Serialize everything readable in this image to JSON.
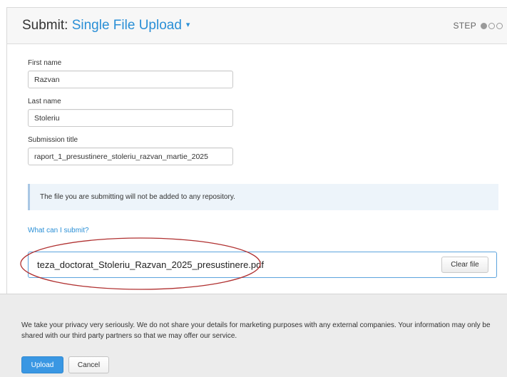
{
  "header": {
    "title_prefix": "Submit: ",
    "title_dropdown": "Single File Upload",
    "caret": "▾",
    "step_label": "STEP",
    "steps_total": 3,
    "current_step": 1
  },
  "form": {
    "first_name": {
      "label": "First name",
      "value": "Razvan"
    },
    "last_name": {
      "label": "Last name",
      "value": "Stoleriu"
    },
    "submission_title": {
      "label": "Submission title",
      "value": "raport_1_presustinere_stoleriu_razvan_martie_2025"
    }
  },
  "info_message": "The file you are submitting will not be added to any repository.",
  "help_link": "What can I submit?",
  "file": {
    "name": "teza_doctorat_Stoleriu_Razvan_2025_presustinere.pdf",
    "clear_label": "Clear file"
  },
  "annotation_color": "#b03030",
  "footer": {
    "privacy_text": "We take your privacy very seriously. We do not share your details for marketing purposes with any external companies. Your information may only be shared with our third party partners so that we may offer our service.",
    "upload_label": "Upload",
    "cancel_label": "Cancel"
  },
  "colors": {
    "accent": "#2a8fd6",
    "upload_button": "#3a97e3",
    "info_background": "#edf4fa"
  }
}
